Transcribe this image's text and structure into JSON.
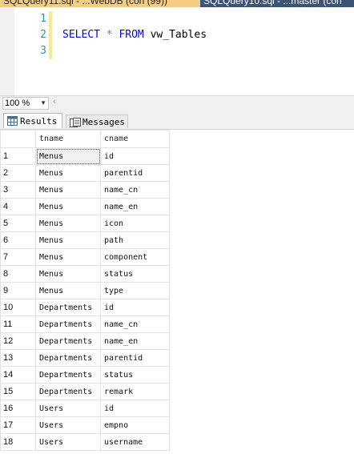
{
  "tabs": [
    {
      "label": "SQLQuery11.sql - ...WebDB (con (99))",
      "active": true
    },
    {
      "label": "SQLQuery10.sql - ...master (con",
      "active": false
    }
  ],
  "editor": {
    "line_numbers": [
      "1",
      "2",
      "3"
    ],
    "query": {
      "kw1": "SELECT",
      "star": "*",
      "kw2": "FROM",
      "object": "vw_Tables"
    }
  },
  "zoom": {
    "value": "100 %"
  },
  "result_tabs": {
    "results": "Results",
    "messages": "Messages"
  },
  "grid": {
    "columns": [
      "tname",
      "cname"
    ],
    "rows": [
      {
        "n": "1",
        "tname": "Menus",
        "cname": "id"
      },
      {
        "n": "2",
        "tname": "Menus",
        "cname": "parentid"
      },
      {
        "n": "3",
        "tname": "Menus",
        "cname": "name_cn"
      },
      {
        "n": "4",
        "tname": "Menus",
        "cname": "name_en"
      },
      {
        "n": "5",
        "tname": "Menus",
        "cname": "icon"
      },
      {
        "n": "6",
        "tname": "Menus",
        "cname": "path"
      },
      {
        "n": "7",
        "tname": "Menus",
        "cname": "component"
      },
      {
        "n": "8",
        "tname": "Menus",
        "cname": "status"
      },
      {
        "n": "9",
        "tname": "Menus",
        "cname": "type"
      },
      {
        "n": "10",
        "tname": "Departments",
        "cname": "id"
      },
      {
        "n": "11",
        "tname": "Departments",
        "cname": "name_cn"
      },
      {
        "n": "12",
        "tname": "Departments",
        "cname": "name_en"
      },
      {
        "n": "13",
        "tname": "Departments",
        "cname": "parentid"
      },
      {
        "n": "14",
        "tname": "Departments",
        "cname": "status"
      },
      {
        "n": "15",
        "tname": "Departments",
        "cname": "remark"
      },
      {
        "n": "16",
        "tname": "Users",
        "cname": "id"
      },
      {
        "n": "17",
        "tname": "Users",
        "cname": "empno"
      },
      {
        "n": "18",
        "tname": "Users",
        "cname": "username"
      }
    ]
  }
}
